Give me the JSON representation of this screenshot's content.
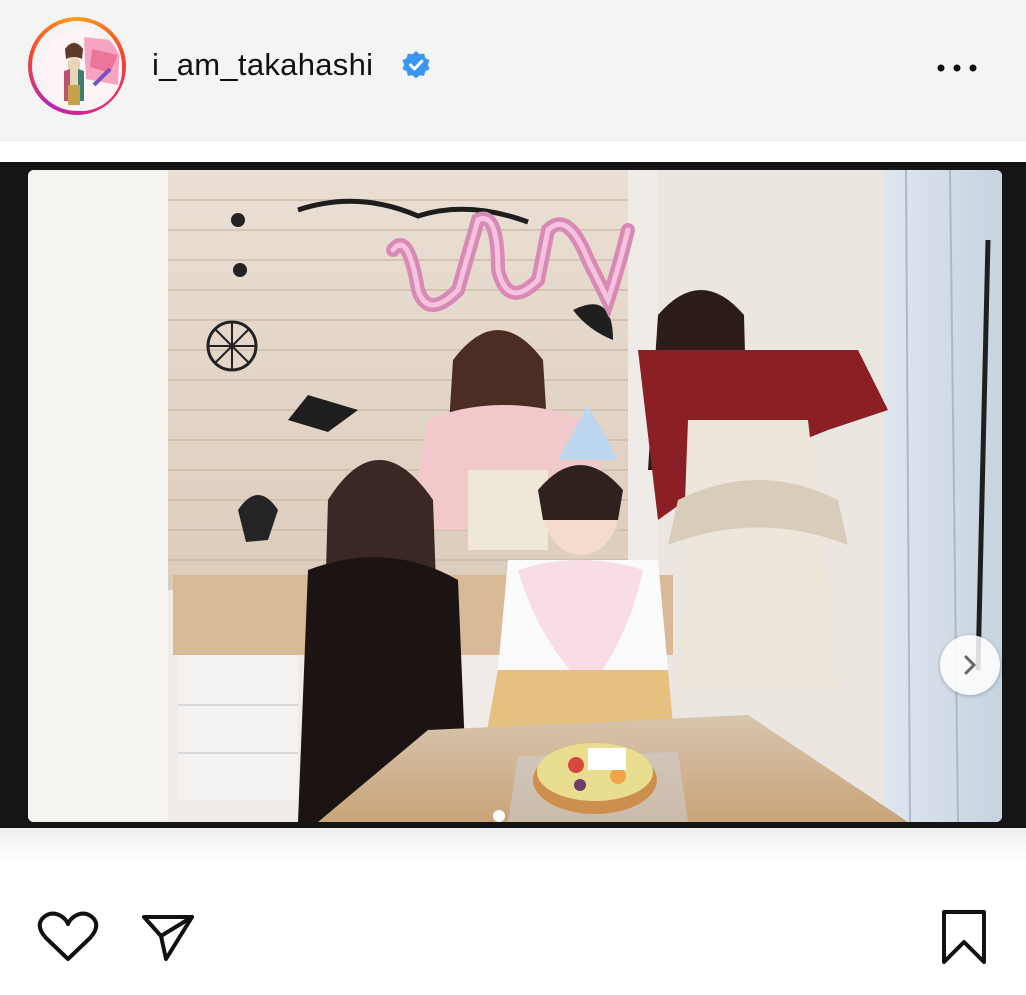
{
  "post_header": {
    "username": "i_am_takahashi",
    "verified": true,
    "avatar_icon": "profile-avatar",
    "more_icon": "more-horizontal-icon"
  },
  "post_media": {
    "slide_indicator": {
      "current": 1
    },
    "next_icon": "chevron-right-icon",
    "photo_alt_visible_text": ""
  },
  "actions": {
    "like_icon": "heart-icon",
    "share_icon": "send-icon",
    "save_icon": "bookmark-icon"
  },
  "colors": {
    "verified_blue": "#3897f0",
    "ring_orange": "#f9a21a",
    "ring_pink": "#e2286f",
    "ring_purple": "#b526b6",
    "text_primary": "#111111"
  }
}
